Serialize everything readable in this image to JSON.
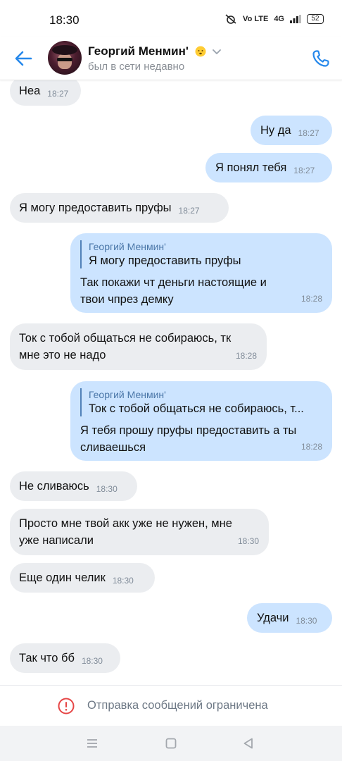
{
  "status_bar": {
    "time": "18:30",
    "volte": "Vo LTE",
    "network": "4G",
    "battery": "52"
  },
  "header": {
    "contact_name": "Георгий Менмин'",
    "contact_status": "был в сети недавно",
    "emoji": "😶",
    "accent_color": "#2688eb"
  },
  "messages": [
    {
      "dir": "in",
      "text": "Неа",
      "time": "18:27"
    },
    {
      "dir": "out",
      "text": "Ну да",
      "time": "18:27"
    },
    {
      "dir": "out",
      "text": "Я понял тебя",
      "time": "18:27"
    },
    {
      "dir": "in",
      "text": "Я могу предоставить пруфы",
      "time": "18:27"
    },
    {
      "dir": "out",
      "reply_author": "Георгий Менмин'",
      "reply_text": "Я могу предоставить пруфы",
      "line1": "Так покажи чт деньги настоящие и",
      "line2": "твои чпрез демку",
      "time": "18:28"
    },
    {
      "dir": "in",
      "line1": "Ток с тобой общаться не собираюсь, тк",
      "line2": "мне это не надо",
      "time": "18:28"
    },
    {
      "dir": "out",
      "reply_author": "Георгий Менмин'",
      "reply_text": "Ток с тобой общаться не собираюсь, т...",
      "line1": "Я тебя прошу пруфы предоставить а ты",
      "line2": "сливаешься",
      "time": "18:28"
    },
    {
      "dir": "in",
      "text": "Не сливаюсь",
      "time": "18:30"
    },
    {
      "dir": "in",
      "line1": "Просто мне твой акк уже не нужен, мне",
      "line2": "уже написали",
      "time": "18:30"
    },
    {
      "dir": "in",
      "text": "Еще один челик",
      "time": "18:30"
    },
    {
      "dir": "out",
      "text": "Удачи",
      "time": "18:30"
    },
    {
      "dir": "in",
      "text": "Так что бб",
      "time": "18:30"
    }
  ],
  "restricted": {
    "label": "Отправка сообщений ограничена",
    "icon_color": "#e64646"
  },
  "navbar": {
    "icons": [
      "menu-icon",
      "home-icon",
      "back-triangle-icon"
    ]
  }
}
